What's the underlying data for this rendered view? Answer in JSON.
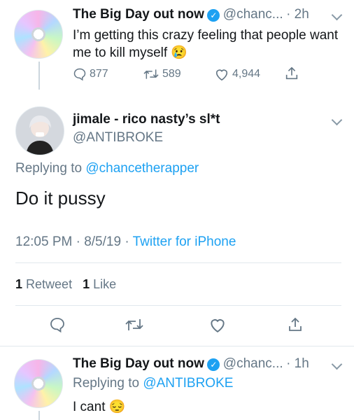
{
  "tweet1": {
    "display_name": "The Big Day out now",
    "handle": "@chanc...",
    "time": "· 2h",
    "text": "I’m getting this crazy feeling that people want me to kill myself 😢",
    "replies": "877",
    "retweets": "589",
    "likes": "4,944"
  },
  "main_tweet": {
    "display_name": "jimale - rico nasty’s sl*t",
    "handle": "@ANTIBROKE",
    "replying_prefix": "Replying to",
    "replying_to": "@chancetherapper",
    "text": "Do it pussy",
    "timestamp": "12:05 PM · 8/5/19 ·",
    "source": "Twitter for iPhone",
    "retweet_count": "1",
    "retweet_label": "Retweet",
    "like_count": "1",
    "like_label": "Like"
  },
  "reply_tweet": {
    "display_name": "The Big Day out now",
    "handle": "@chanc...",
    "time": "· 1h",
    "replying_prefix": "Replying to",
    "replying_to": "@ANTIBROKE",
    "text": "I cant 😔"
  },
  "icons": {
    "reply": "reply-icon",
    "retweet": "retweet-icon",
    "like": "heart-icon",
    "share": "share-icon",
    "verified": "verified-badge-icon",
    "menu": "chevron-down-icon"
  },
  "colors": {
    "accent": "#1da1f2",
    "muted": "#657786",
    "divider": "#e1e8ed"
  }
}
